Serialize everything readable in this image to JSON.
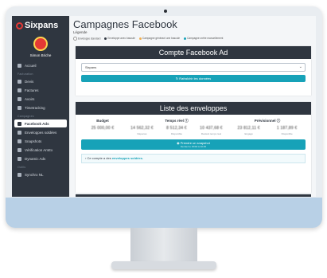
{
  "app": {
    "brand": "Sixpans",
    "user": "Simon Briche",
    "accent": "#17a2b8",
    "sidebar_bg": "#2f3640",
    "brand_color": "#e53935"
  },
  "sidebar": {
    "home": "Accueil",
    "section_1": "Facturation",
    "items_1": [
      "Devis",
      "Factures",
      "Avoirs",
      "Timetracking"
    ],
    "section_2": "Campagnes",
    "items_2": [
      "Facebook Ads",
      "Enveloppes soldées",
      "Snapshots",
      "Vérification AmEx",
      "Dynamic Ads"
    ],
    "section_3": "Outils",
    "items_3": [
      "Synchro NL"
    ]
  },
  "page": {
    "title": "Campagnes Facebook",
    "legend_title": "Légende",
    "legend": [
      {
        "label": "Enveloppe standard",
        "color": "#ffffff"
      },
      {
        "label": "Enveloppe avec bascule",
        "color": "#2f3640"
      },
      {
        "label": "Campagne générant une bascule",
        "color": "#f0ad4e"
      },
      {
        "label": "Campagne créée manuellement",
        "color": "#17a2b8"
      }
    ]
  },
  "account_card": {
    "title": "Compte Facebook Ad",
    "select_value": "Sixpans",
    "refresh_label": "Rafraîchir les données"
  },
  "envelopes_card": {
    "title": "Liste des enveloppes",
    "budget_label": "Budget",
    "realtime_label": "Temps réel",
    "forecast_label": "Prévisionnel",
    "budget_value": "25 000,00 €",
    "realtime": [
      {
        "value": "14 562,32 €",
        "sub": "Dépensé"
      },
      {
        "value": "8 512,34 €",
        "sub": "Disponible"
      },
      {
        "value": "10 437,68 €",
        "sub": "Restant temps réel"
      }
    ],
    "forecast": [
      {
        "value": "23 812,11 €",
        "sub": "Engagé"
      },
      {
        "value": "1 187,89 €",
        "sub": "Disponible"
      }
    ],
    "snapshot_label": "Prendre un snapshot",
    "snapshot_sub": "Dernier le 15/02 à 10:45",
    "info_prefix": "Ce compte a des",
    "info_link": "enveloppes soldées."
  }
}
